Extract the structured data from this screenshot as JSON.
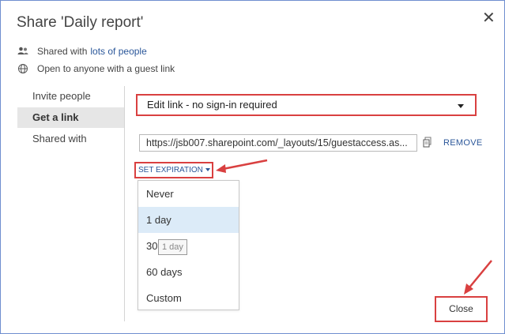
{
  "dialog": {
    "title": "Share 'Daily report'",
    "close_glyph": "✕"
  },
  "info": {
    "shared_prefix": "Shared with",
    "shared_link": "lots of people",
    "guest_text": "Open to anyone with a guest link",
    "shared_icon": "people-icon",
    "guest_icon": "globe-icon"
  },
  "sidebar": {
    "items": [
      {
        "label": "Invite people"
      },
      {
        "label": "Get a link"
      },
      {
        "label": "Shared with"
      }
    ],
    "active_index": 1
  },
  "link_panel": {
    "permission_value": "Edit link - no sign-in required",
    "url": "https://jsb007.sharepoint.com/_layouts/15/guestaccess.as...",
    "remove_label": "REMOVE",
    "expiration_label": "SET EXPIRATION",
    "expiration_options": [
      {
        "label": "Never"
      },
      {
        "label": "1 day"
      },
      {
        "label": "30 days"
      },
      {
        "label": "60 days"
      },
      {
        "label": "Custom"
      }
    ],
    "hovered_option_index": 1,
    "tooltip_text": "1 day"
  },
  "footer": {
    "close_label": "Close"
  },
  "colors": {
    "accent_link": "#2b579a",
    "highlight_border": "#d94040",
    "hover_bg": "#dcebf8",
    "active_tab_bg": "#e6e6e6"
  }
}
